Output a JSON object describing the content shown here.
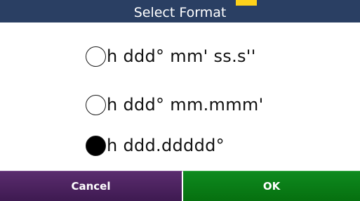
{
  "header": {
    "title": "Select Format"
  },
  "options": [
    {
      "label": "h ddd° mm' ss.s''",
      "selected": false
    },
    {
      "label": "h ddd° mm.mmm'",
      "selected": false
    },
    {
      "label": "h ddd.ddddd°",
      "selected": true
    }
  ],
  "buttons": {
    "cancel_label": "Cancel",
    "ok_label": "OK"
  },
  "colors": {
    "title_bar": "#2a3f63",
    "title_accent": "#ffd21a",
    "cancel_button": "#4a2160",
    "ok_button": "#0a7d18"
  }
}
